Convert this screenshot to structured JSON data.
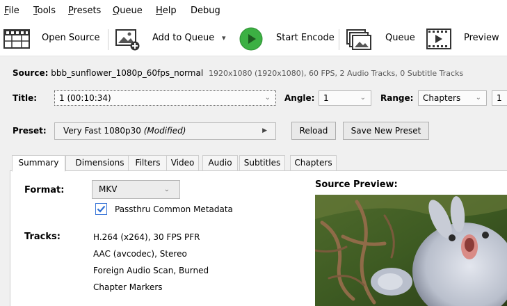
{
  "menu": {
    "file": {
      "u": "F",
      "rest": "ile"
    },
    "tools": {
      "u": "T",
      "rest": "ools"
    },
    "presets": {
      "u": "P",
      "rest": "resets"
    },
    "queue": {
      "u": "Q",
      "rest": "ueue"
    },
    "help": {
      "u": "H",
      "rest": "elp"
    },
    "debug": "Debug"
  },
  "toolbar": {
    "open_source": "Open Source",
    "add_to_queue": "Add to Queue",
    "add_to_queue_arrow": "▾",
    "start_encode": "Start Encode",
    "queue": "Queue",
    "preview": "Preview"
  },
  "source": {
    "label": "Source:",
    "name": "bbb_sunflower_1080p_60fps_normal",
    "details": "1920x1080 (1920x1080), 60 FPS, 2 Audio Tracks, 0 Subtitle Tracks"
  },
  "title_row": {
    "title_label": "Title:",
    "title_value": "1 (00:10:34)",
    "angle_label": "Angle:",
    "angle_value": "1",
    "range_label": "Range:",
    "range_value": "Chapters",
    "range_start": "1"
  },
  "preset_row": {
    "label": "Preset:",
    "value": "Very Fast 1080p30",
    "modified": "(Modified)",
    "reload": "Reload",
    "save_new": "Save New Preset"
  },
  "tabs": [
    "Summary",
    "Dimensions",
    "Filters",
    "Video",
    "Audio",
    "Subtitles",
    "Chapters"
  ],
  "summary": {
    "format_label": "Format:",
    "format_value": "MKV",
    "passthru_label": "Passthru Common Metadata",
    "passthru_checked": true,
    "tracks_label": "Tracks:",
    "tracks": [
      "H.264 (x264), 30 FPS PFR",
      "AAC (avcodec), Stereo",
      "Foreign Audio Scan, Burned",
      "Chapter Markers"
    ],
    "source_preview_label": "Source Preview:"
  },
  "colors": {
    "accent": "#3a76d8",
    "play_green": "#3cb043"
  }
}
